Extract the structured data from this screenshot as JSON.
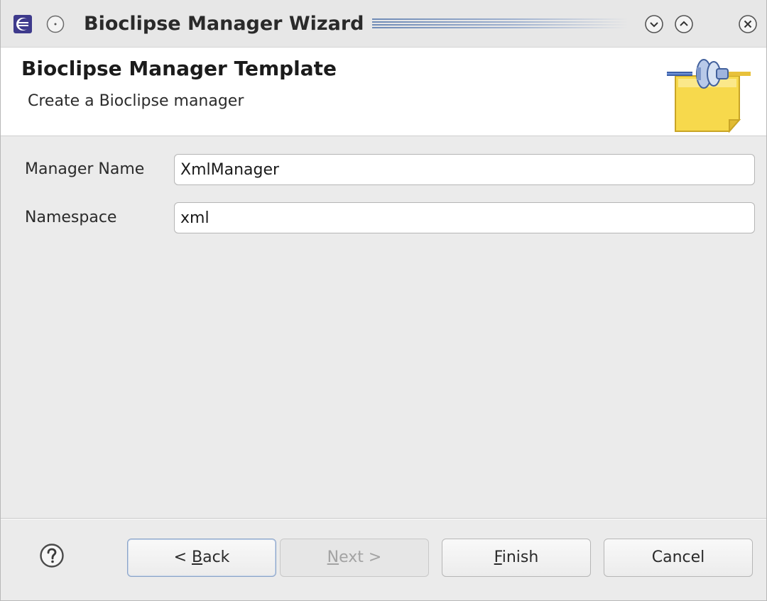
{
  "window": {
    "title": "Bioclipse Manager Wizard",
    "controls": {
      "menu_icon": "window-menu-circle-icon",
      "minimize_icon": "chevron-down-circle-icon",
      "maximize_icon": "chevron-up-circle-icon",
      "close_icon": "close-circle-icon"
    }
  },
  "header": {
    "title": "Bioclipse Manager Template",
    "subtitle": "Create a Bioclipse manager",
    "graphic_icon": "wizard-plug-document-icon"
  },
  "form": {
    "manager_name": {
      "label": "Manager Name",
      "value": "XmlManager"
    },
    "namespace": {
      "label": "Namespace",
      "value": "xml"
    }
  },
  "buttons": {
    "help_icon": "question-mark-icon",
    "back": {
      "prefix": "< ",
      "mnemonic": "B",
      "rest": "ack",
      "enabled": true
    },
    "next": {
      "mnemonic": "N",
      "rest": "ext >",
      "enabled": false
    },
    "finish": {
      "mnemonic": "F",
      "rest": "inish",
      "enabled": true
    },
    "cancel": {
      "label": "Cancel",
      "enabled": true
    }
  },
  "colors": {
    "window_bg": "#ebebeb",
    "header_bg": "#ffffff",
    "focus_border": "#8aa3c8",
    "disabled_text": "#a3a3a3"
  }
}
